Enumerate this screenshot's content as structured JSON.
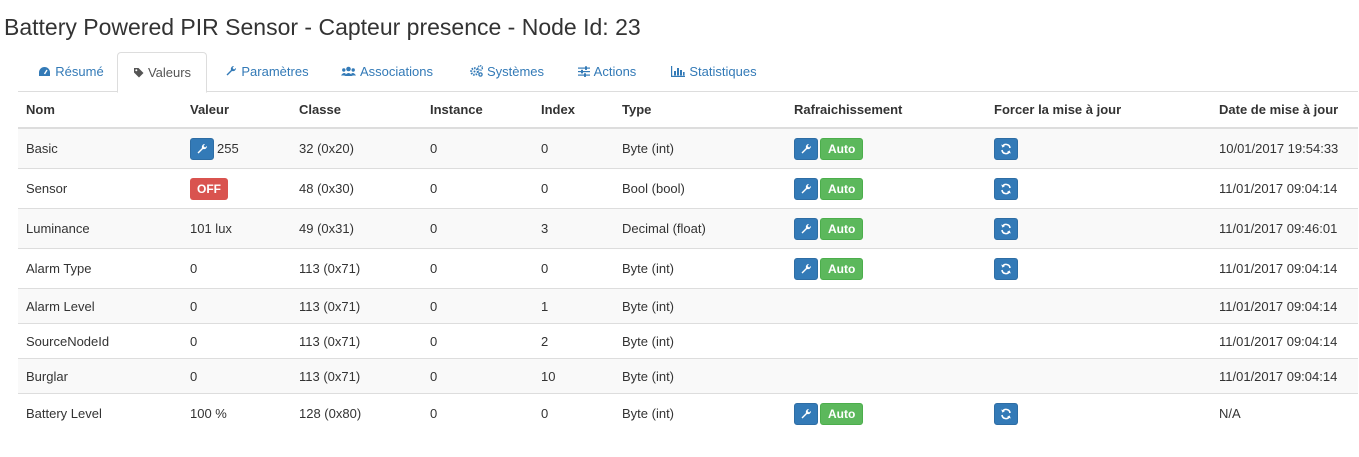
{
  "page_title": "Battery Powered PIR Sensor - Capteur presence - Node Id: 23",
  "tabs": [
    {
      "label": "Résumé",
      "icon": "dashboard-icon"
    },
    {
      "label": "Valeurs",
      "icon": "tag-icon",
      "active": true
    },
    {
      "label": "Paramètres",
      "icon": "wrench-icon"
    },
    {
      "label": "Associations",
      "icon": "users-icon"
    },
    {
      "label": "Systèmes",
      "icon": "cogs-icon"
    },
    {
      "label": "Actions",
      "icon": "sliders-icon"
    },
    {
      "label": "Statistiques",
      "icon": "bar-chart-icon"
    }
  ],
  "table": {
    "headers": [
      "Nom",
      "Valeur",
      "Classe",
      "Instance",
      "Index",
      "Type",
      "Rafraichissement",
      "Forcer la mise à jour",
      "Date de mise à jour"
    ],
    "auto_label": "Auto",
    "rows": [
      {
        "nom": "Basic",
        "valeur": "255",
        "valeur_has_wrench": true,
        "classe": "32 (0x20)",
        "instance": "0",
        "index": "0",
        "type": "Byte (int)",
        "refresh": true,
        "force": true,
        "date": "10/01/2017 19:54:33"
      },
      {
        "nom": "Sensor",
        "valeur": "OFF",
        "valeur_badge": true,
        "classe": "48 (0x30)",
        "instance": "0",
        "index": "0",
        "type": "Bool (bool)",
        "refresh": true,
        "force": true,
        "date": "11/01/2017 09:04:14"
      },
      {
        "nom": "Luminance",
        "valeur": "101 lux",
        "classe": "49 (0x31)",
        "instance": "0",
        "index": "3",
        "type": "Decimal (float)",
        "refresh": true,
        "force": true,
        "date": "11/01/2017 09:46:01"
      },
      {
        "nom": "Alarm Type",
        "valeur": "0",
        "classe": "113 (0x71)",
        "instance": "0",
        "index": "0",
        "type": "Byte (int)",
        "refresh": true,
        "force": true,
        "date": "11/01/2017 09:04:14"
      },
      {
        "nom": "Alarm Level",
        "valeur": "0",
        "classe": "113 (0x71)",
        "instance": "0",
        "index": "1",
        "type": "Byte (int)",
        "refresh": false,
        "force": false,
        "date": "11/01/2017 09:04:14"
      },
      {
        "nom": "SourceNodeId",
        "valeur": "0",
        "classe": "113 (0x71)",
        "instance": "0",
        "index": "2",
        "type": "Byte (int)",
        "refresh": false,
        "force": false,
        "date": "11/01/2017 09:04:14"
      },
      {
        "nom": "Burglar",
        "valeur": "0",
        "classe": "113 (0x71)",
        "instance": "0",
        "index": "10",
        "type": "Byte (int)",
        "refresh": false,
        "force": false,
        "date": "11/01/2017 09:04:14"
      },
      {
        "nom": "Battery Level",
        "valeur": "100 %",
        "classe": "128 (0x80)",
        "instance": "0",
        "index": "0",
        "type": "Byte (int)",
        "refresh": true,
        "force": true,
        "date": "N/A"
      }
    ]
  }
}
